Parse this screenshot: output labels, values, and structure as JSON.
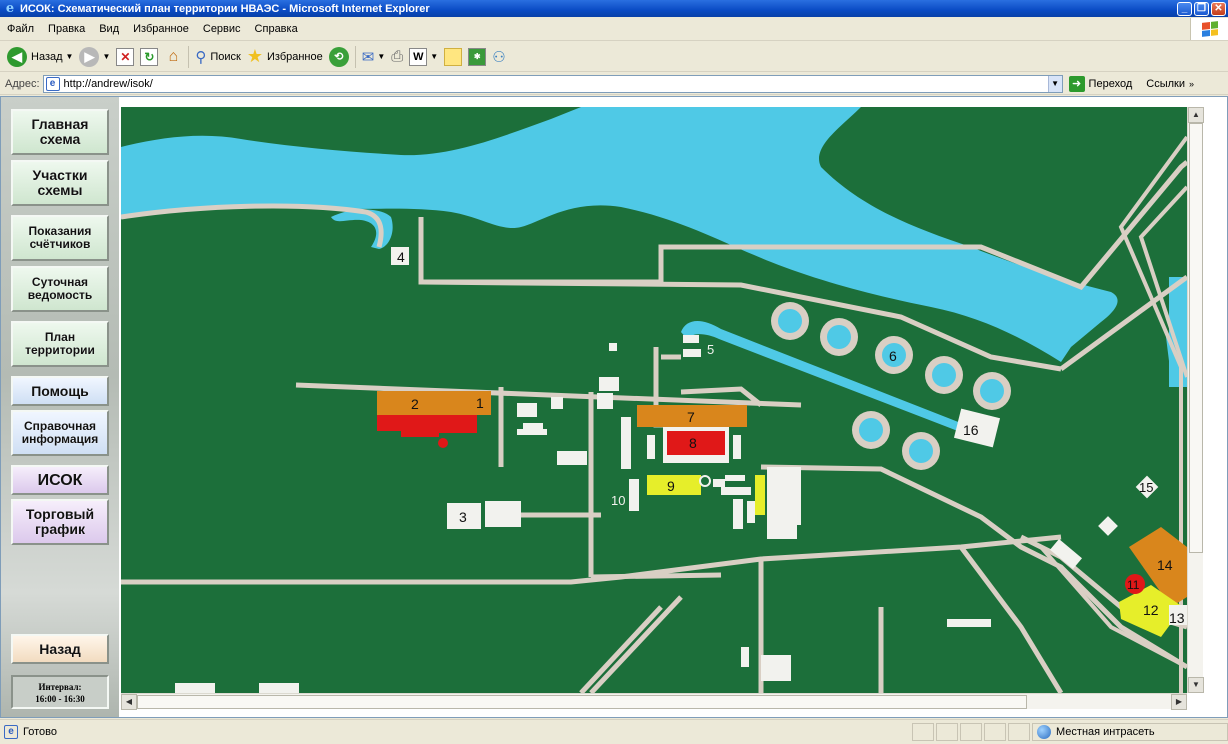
{
  "window": {
    "title": "ИСОК: Схематический план территории НВАЭС - Microsoft Internet Explorer",
    "controls": [
      "minimize",
      "restore",
      "close"
    ]
  },
  "menu": {
    "items": [
      "Файл",
      "Правка",
      "Вид",
      "Избранное",
      "Сервис",
      "Справка"
    ]
  },
  "toolbar": {
    "back_label": "Назад",
    "search_label": "Поиск",
    "favorites_label": "Избранное"
  },
  "address": {
    "label": "Адрес:",
    "url": "http://andrew/isok/",
    "go_label": "Переход",
    "links_label": "Ссылки"
  },
  "sidebar": {
    "buttons": [
      {
        "label": "Главная\nсхема",
        "style": "green"
      },
      {
        "label": "Участки\nсхемы",
        "style": "green"
      },
      {
        "label": "Показания\nсчётчиков",
        "style": "green"
      },
      {
        "label": "Суточная\nведомость",
        "style": "green"
      },
      {
        "label": "План\nтерритории",
        "style": "green"
      },
      {
        "label": "Помощь",
        "style": "blue"
      },
      {
        "label": "Справочная\nинформация",
        "style": "blue"
      },
      {
        "label": "ИСОК",
        "style": "purple"
      },
      {
        "label": "Торговый\nграфик",
        "style": "purple"
      },
      {
        "label": "Назад",
        "style": "peach"
      }
    ],
    "interval_label": "Интервал:",
    "interval_value": "16:00 - 16:30"
  },
  "map": {
    "colors": {
      "ground": "#1c6f3a",
      "water": "#4fc9e6",
      "road": "#d9cfc4",
      "orange": "#d9861c",
      "red": "#e01818",
      "yellow": "#e6ee2a",
      "building": "#f2f2ee"
    },
    "labels": [
      "1",
      "2",
      "3",
      "4",
      "5",
      "6",
      "7",
      "8",
      "9",
      "10",
      "11",
      "12",
      "13",
      "14",
      "15",
      "16"
    ]
  },
  "status": {
    "text": "Готово",
    "zone": "Местная интрасеть"
  }
}
